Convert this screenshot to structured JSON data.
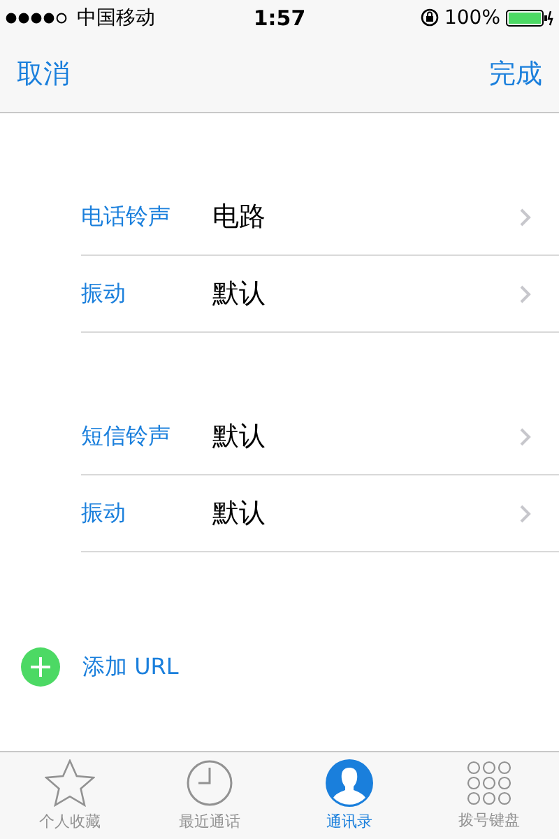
{
  "status_bar": {
    "carrier": "中国移动",
    "time": "1:57",
    "battery": "100%"
  },
  "nav": {
    "left": "取消",
    "right": "完成"
  },
  "groups": [
    {
      "rows": [
        {
          "label": "电话铃声",
          "value": "电路"
        },
        {
          "label": "振动",
          "value": "默认"
        }
      ]
    },
    {
      "rows": [
        {
          "label": "短信铃声",
          "value": "默认"
        },
        {
          "label": "振动",
          "value": "默认"
        }
      ]
    }
  ],
  "add_row": {
    "label": "添加 URL"
  },
  "tabs": [
    {
      "label": "个人收藏",
      "kind": "star",
      "selected": false
    },
    {
      "label": "最近通话",
      "kind": "clock",
      "selected": false
    },
    {
      "label": "通讯录",
      "kind": "person",
      "selected": true
    },
    {
      "label": "拨号键盘",
      "kind": "keypad",
      "selected": false
    }
  ]
}
